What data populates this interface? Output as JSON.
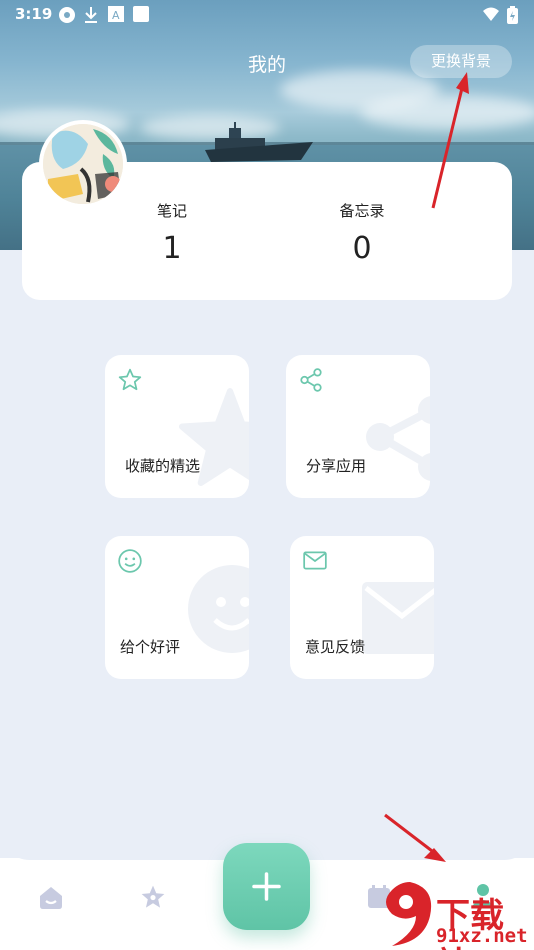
{
  "status_bar": {
    "time": "3:19"
  },
  "header": {
    "title": "我的",
    "change_background_label": "更换背景"
  },
  "stats": [
    {
      "label": "笔记",
      "value": "1"
    },
    {
      "label": "备忘录",
      "value": "0"
    }
  ],
  "tiles": [
    {
      "label": "收藏的精选",
      "icon": "star-icon"
    },
    {
      "label": "分享应用",
      "icon": "share-icon"
    },
    {
      "label": "给个好评",
      "icon": "smiley-icon"
    },
    {
      "label": "意见反馈",
      "icon": "mail-icon"
    }
  ],
  "bottom_nav": {
    "items": [
      "home-icon",
      "star-icon",
      "add-button",
      "calendar-icon",
      "profile-icon"
    ]
  },
  "watermark": {
    "line1": "下载站",
    "line2": "91xz.net"
  },
  "colors": {
    "accent": "#5fc4a6",
    "icon_tint": "#6cc7ad",
    "annotation_arrow": "#d9242a"
  }
}
